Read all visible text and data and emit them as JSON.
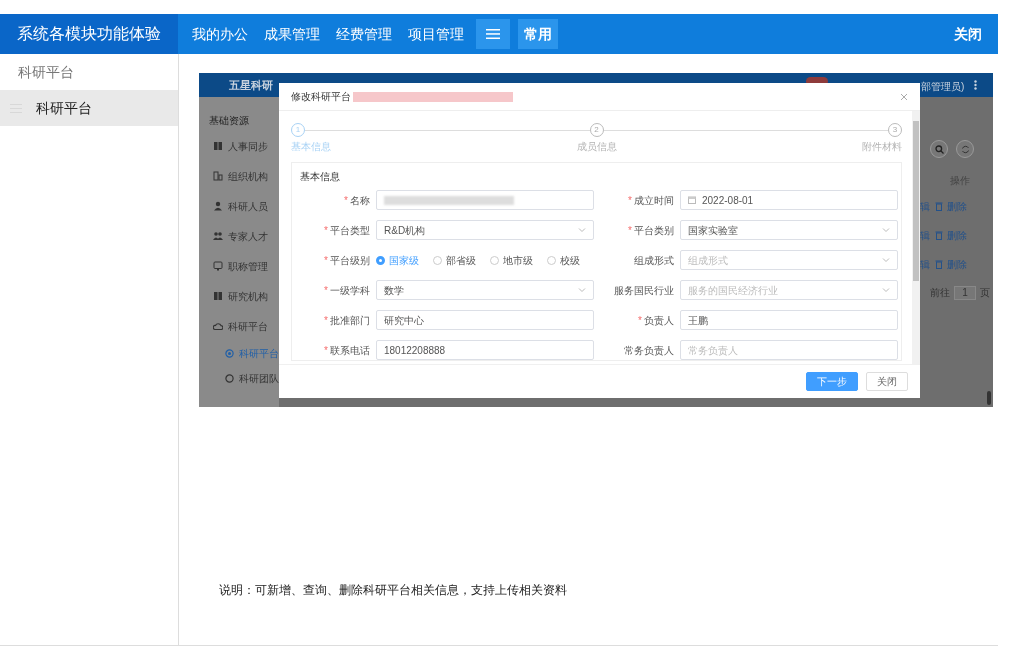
{
  "app": {
    "title": "系统各模块功能体验",
    "nav": [
      "我的办公",
      "成果管理",
      "经费管理",
      "项目管理"
    ],
    "pinned": "常用",
    "close": "关闭"
  },
  "sidebar": {
    "heading": "科研平台",
    "items": [
      {
        "label": "科研平台",
        "selected": true
      }
    ]
  },
  "screenshot": {
    "header": {
      "brand": "五星科研",
      "user": "部管理员)"
    },
    "menu": {
      "heading": "基础资源",
      "items": [
        {
          "label": "人事同步"
        },
        {
          "label": "组织机构"
        },
        {
          "label": "科研人员"
        },
        {
          "label": "专家人才"
        },
        {
          "label": "职称管理"
        },
        {
          "label": "研究机构"
        },
        {
          "label": "科研平台",
          "children": [
            {
              "label": "科研平台",
              "selected": true
            },
            {
              "label": "科研团队",
              "selected": false
            }
          ]
        }
      ]
    },
    "table": {
      "column": "操作",
      "rows": [
        {
          "edit": "辑",
          "delete": "删除"
        },
        {
          "edit": "辑",
          "delete": "删除"
        },
        {
          "edit": "辑",
          "delete": "删除"
        }
      ],
      "pager": {
        "label": "前往",
        "page": "1",
        "unit": "页"
      }
    },
    "dialog": {
      "title": "修改科研平台",
      "steps": [
        {
          "number": "1",
          "label": "基本信息",
          "selected": true
        },
        {
          "number": "2",
          "label": "成员信息",
          "selected": false
        },
        {
          "number": "3",
          "label": "附件材料",
          "selected": false
        }
      ],
      "section": "基本信息",
      "fields": [
        {
          "label": "名称",
          "required_mark": "*",
          "kind": "redacted"
        },
        {
          "label": "成立时间",
          "required_mark": "*",
          "kind": "date",
          "value": "2022-08-01"
        },
        {
          "label": "平台类型",
          "required_mark": "*",
          "kind": "select",
          "value": "R&D机构"
        },
        {
          "label": "平台类别",
          "required_mark": "*",
          "kind": "select",
          "value": "国家实验室"
        },
        {
          "label": "平台级别",
          "required_mark": "*",
          "kind": "radio",
          "options": [
            {
              "label": "国家级",
              "selected": true
            },
            {
              "label": "部省级",
              "selected": false
            },
            {
              "label": "地市级",
              "selected": false
            },
            {
              "label": "校级",
              "selected": false
            }
          ]
        },
        {
          "label": "组成形式",
          "kind": "select",
          "placeholder": "组成形式"
        },
        {
          "label": "一级学科",
          "required_mark": "*",
          "kind": "select",
          "value": "数学"
        },
        {
          "label": "服务国民行业",
          "kind": "select",
          "placeholder": "服务的国民经济行业"
        },
        {
          "label": "批准部门",
          "required_mark": "*",
          "kind": "text",
          "value": "研究中心"
        },
        {
          "label": "负责人",
          "required_mark": "*",
          "kind": "text",
          "value": "王鹏"
        },
        {
          "label": "联系电话",
          "required_mark": "*",
          "kind": "text",
          "value": "18012208888"
        },
        {
          "label": "常务负责人",
          "kind": "text",
          "placeholder": "常务负责人"
        }
      ],
      "buttons": [
        {
          "label": "下一步",
          "kind": "primary"
        },
        {
          "label": "关闭",
          "kind": "default"
        }
      ]
    }
  },
  "description": "说明：可新增、查询、删除科研平台相关信息，支持上传相关资料"
}
